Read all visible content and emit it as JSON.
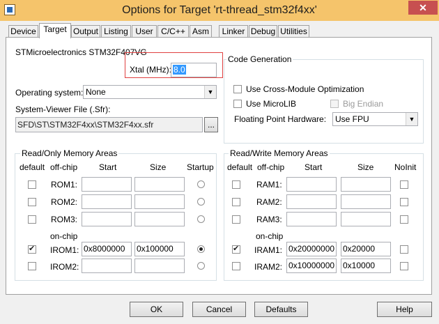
{
  "window": {
    "title": "Options for Target 'rt-thread_stm32f4xx'",
    "close_glyph": "✕"
  },
  "tabs": [
    {
      "label": "Device"
    },
    {
      "label": "Target"
    },
    {
      "label": "Output"
    },
    {
      "label": "Listing"
    },
    {
      "label": "User"
    },
    {
      "label": "C/C++"
    },
    {
      "label": "Asm"
    },
    {
      "label": "Linker"
    },
    {
      "label": "Debug"
    },
    {
      "label": "Utilities"
    }
  ],
  "target": {
    "device_name": "STMicroelectronics STM32F407VG",
    "xtal_label": "Xtal (MHz):",
    "xtal_value": "8.0",
    "os_label": "Operating system:",
    "os_value": "None",
    "sysviewer_label": "System-Viewer File (.Sfr):",
    "sysviewer_value": "SFD\\ST\\STM32F4xx\\STM32F4xx.sfr",
    "browse_label": "...",
    "codegen": {
      "title": "Code Generation",
      "cross_module_label": "Use Cross-Module Optimization",
      "cross_module_checked": false,
      "microlib_label": "Use MicroLIB",
      "microlib_checked": false,
      "big_endian_label": "Big Endian",
      "big_endian_checked": false,
      "fpu_label": "Floating Point Hardware:",
      "fpu_value": "Use FPU"
    },
    "rom": {
      "title": "Read/Only Memory Areas",
      "headers": {
        "default": "default",
        "offchip": "off-chip",
        "start": "Start",
        "size": "Size",
        "extra": "Startup"
      },
      "onchip_label": "on-chip",
      "rows": [
        {
          "name": "ROM1:",
          "start": "",
          "size": "",
          "default": false,
          "extra": false
        },
        {
          "name": "ROM2:",
          "start": "",
          "size": "",
          "default": false,
          "extra": false
        },
        {
          "name": "ROM3:",
          "start": "",
          "size": "",
          "default": false,
          "extra": false
        },
        {
          "name": "IROM1:",
          "start": "0x8000000",
          "size": "0x100000",
          "default": true,
          "extra": true
        },
        {
          "name": "IROM2:",
          "start": "",
          "size": "",
          "default": false,
          "extra": false
        }
      ]
    },
    "ram": {
      "title": "Read/Write Memory Areas",
      "headers": {
        "default": "default",
        "offchip": "off-chip",
        "start": "Start",
        "size": "Size",
        "extra": "NoInit"
      },
      "onchip_label": "on-chip",
      "rows": [
        {
          "name": "RAM1:",
          "start": "",
          "size": "",
          "default": false,
          "extra": false
        },
        {
          "name": "RAM2:",
          "start": "",
          "size": "",
          "default": false,
          "extra": false
        },
        {
          "name": "RAM3:",
          "start": "",
          "size": "",
          "default": false,
          "extra": false
        },
        {
          "name": "IRAM1:",
          "start": "0x20000000",
          "size": "0x20000",
          "default": true,
          "extra": false
        },
        {
          "name": "IRAM2:",
          "start": "0x10000000",
          "size": "0x10000",
          "default": false,
          "extra": false
        }
      ]
    }
  },
  "buttons": {
    "ok": "OK",
    "cancel": "Cancel",
    "defaults": "Defaults",
    "help": "Help"
  },
  "colors": {
    "titlebar": "#f5c46b",
    "close": "#c75050",
    "highlight": "#e04040",
    "selection": "#3399ff"
  }
}
